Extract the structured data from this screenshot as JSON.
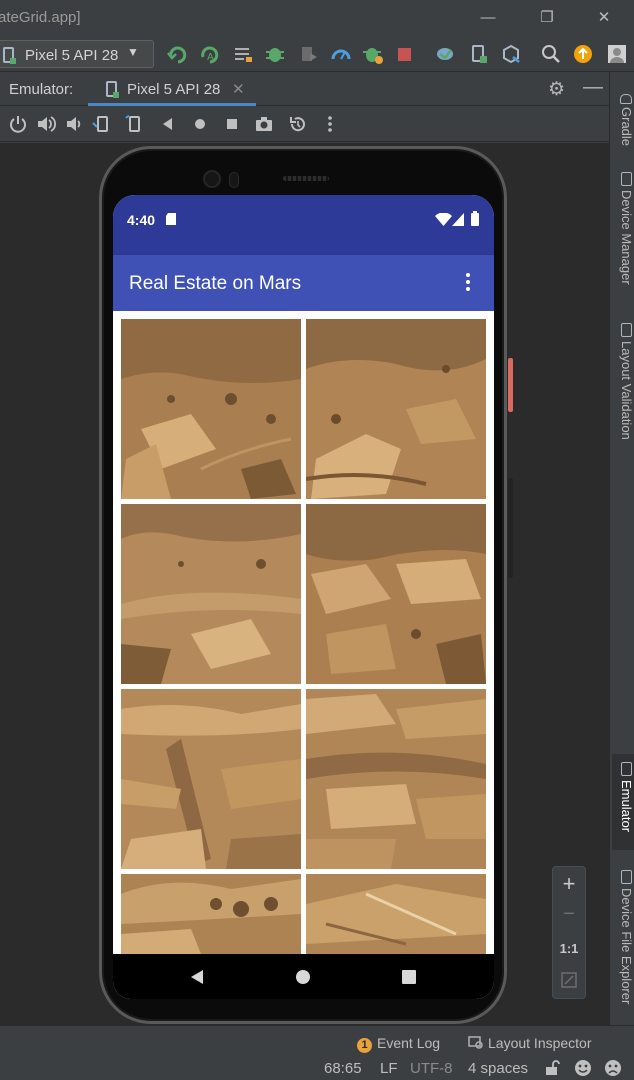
{
  "window": {
    "title": "ateGrid.app]"
  },
  "toolbar": {
    "device_selector": "Pixel 5 API 28"
  },
  "emulator_panel": {
    "label": "Emulator:",
    "tab_label": "Pixel 5 API 28"
  },
  "right_sidebar": {
    "tabs": [
      "Gradle",
      "Device Manager",
      "Layout Validation",
      "Emulator",
      "Device File Explorer"
    ]
  },
  "zoom_controls": {
    "zoom_in": "+",
    "zoom_out": "−",
    "actual_size": "1:1"
  },
  "device": {
    "status_time": "4:40",
    "app_title": "Real Estate on Mars"
  },
  "status_bar": {
    "event_log_count": "1",
    "event_log": "Event Log",
    "layout_inspector": "Layout Inspector",
    "cursor_position": "68:65",
    "line_separator": "LF",
    "encoding": "UTF-8",
    "indent": "4 spaces"
  },
  "colors": {
    "accent": "#4a88c7",
    "app_bar": "#3f51b5",
    "status_bar": "#2e3a98",
    "sand": "#b98a58"
  }
}
